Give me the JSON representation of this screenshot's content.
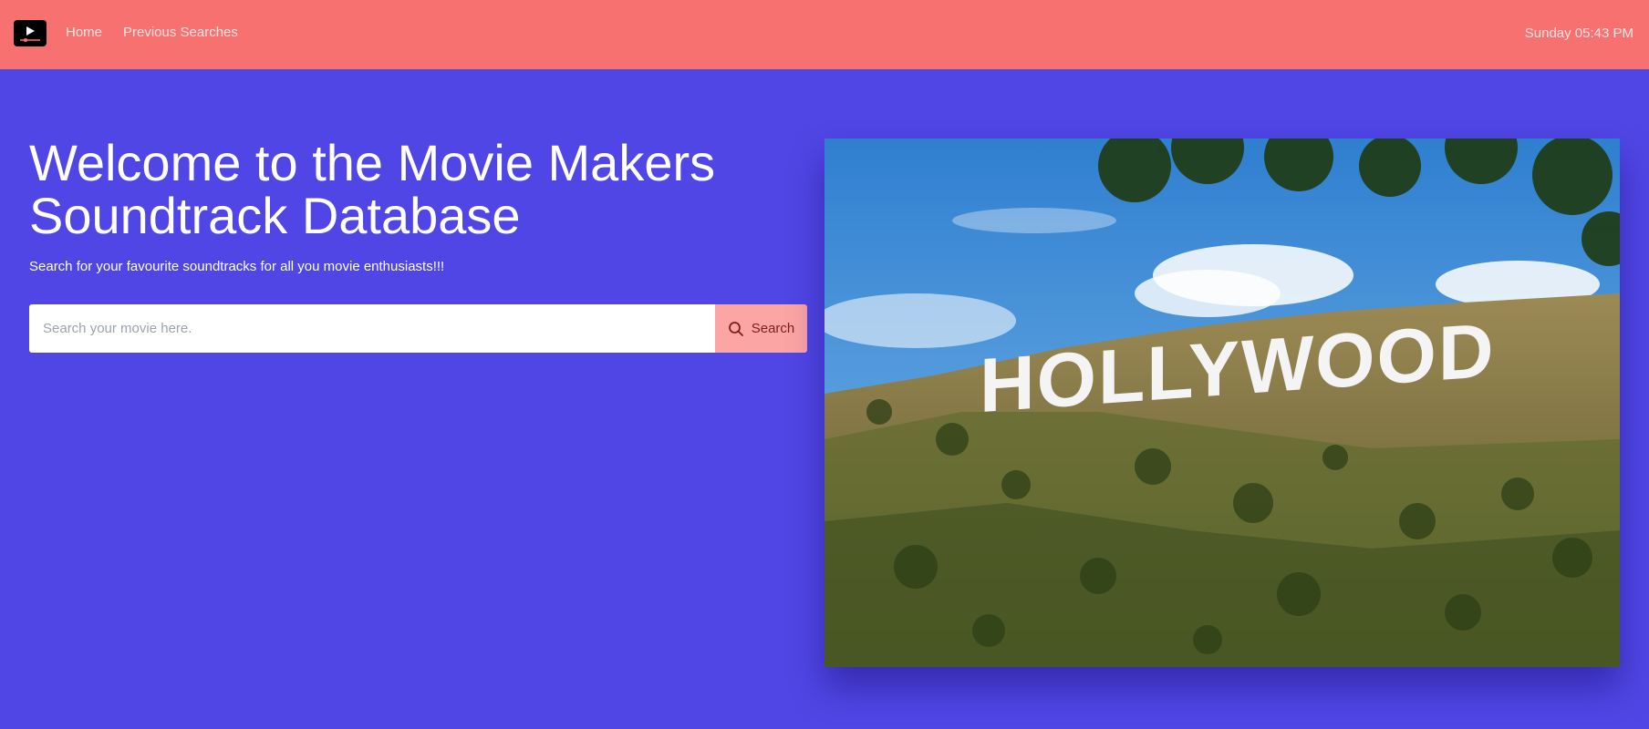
{
  "navbar": {
    "logo_icon": "play-icon",
    "links": [
      {
        "label": "Home"
      },
      {
        "label": "Previous Searches"
      }
    ],
    "clock": "Sunday 05:43 PM"
  },
  "hero": {
    "title": "Welcome to the Movie Makers Soundtrack Database",
    "subtitle": "Search for your favourite soundtracks for all you movie enthusiasts!!!",
    "search": {
      "placeholder": "Search your movie here.",
      "button_label": "Search",
      "button_icon": "search-icon"
    },
    "image": {
      "sign_text": "HOLLYWOOD"
    }
  },
  "colors": {
    "navbar_bg": "#f87171",
    "page_bg": "#5046e5",
    "search_button_bg": "#fca5a5",
    "search_button_text": "#7f1d1d"
  }
}
